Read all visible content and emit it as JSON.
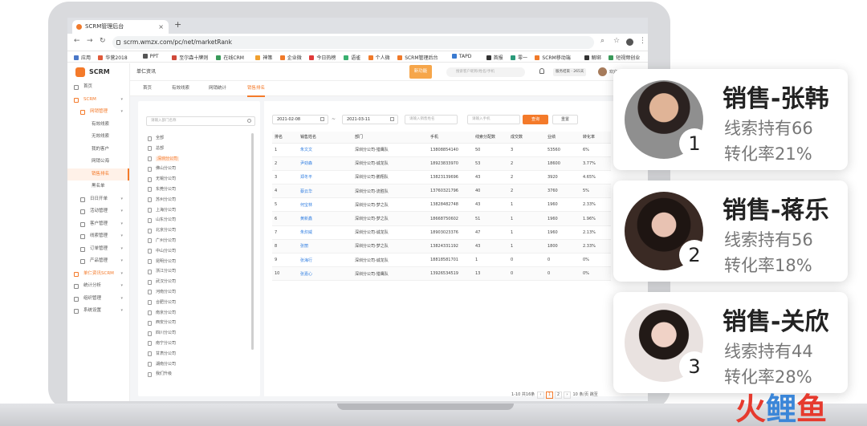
{
  "browser": {
    "tab_title": "SCRM管理后台",
    "url": "scrm.wmzx.com/pc/net/marketRank",
    "bookmarks": [
      "应用",
      "华营2018",
      "PPT",
      "至尔森十牌则",
      "在线CRM",
      "神策",
      "企业微",
      "今日热榜",
      "语雀",
      "个人微",
      "SCRM管理后台",
      "TAPD",
      "首报",
      "零一",
      "SCRM移动端",
      "解绑",
      "短视频创业"
    ]
  },
  "app": {
    "logo": "SCRM",
    "brand": "单仁资讯",
    "new_feature": "新功能",
    "search_placeholder": "搜索客户昵称/姓名/手机",
    "account": "服务结束 · 265天",
    "welcome": "欢迎!"
  },
  "sidebar": [
    {
      "label": "首页",
      "level": 0,
      "style": "normal"
    },
    {
      "label": "SCRM",
      "level": 0,
      "style": "orange",
      "chevron": true
    },
    {
      "label": "网销管理",
      "level": 1,
      "style": "orange",
      "chevron": true
    },
    {
      "label": "有效线索",
      "level": 2,
      "style": "normal"
    },
    {
      "label": "无效线索",
      "level": 2,
      "style": "normal"
    },
    {
      "label": "我的客户",
      "level": 2,
      "style": "normal"
    },
    {
      "label": "网销公海",
      "level": 2,
      "style": "normal"
    },
    {
      "label": "销售排名",
      "level": 2,
      "style": "active"
    },
    {
      "label": "黑名单",
      "level": 2,
      "style": "normal"
    },
    {
      "label": "日日开单",
      "level": 1,
      "style": "normal",
      "chevron": true
    },
    {
      "label": "活动管理",
      "level": 1,
      "style": "normal",
      "chevron": true
    },
    {
      "label": "客户管理",
      "level": 1,
      "style": "normal",
      "chevron": true
    },
    {
      "label": "线索管理",
      "level": 1,
      "style": "normal",
      "chevron": true
    },
    {
      "label": "订单管理",
      "level": 1,
      "style": "normal",
      "chevron": true
    },
    {
      "label": "产品管理",
      "level": 1,
      "style": "normal",
      "chevron": true
    },
    {
      "label": "单仁资讯SCRM",
      "level": 0,
      "style": "orange",
      "chevron": true
    },
    {
      "label": "统计分析",
      "level": 0,
      "style": "normal",
      "chevron": true
    },
    {
      "label": "组织管理",
      "level": 0,
      "style": "normal",
      "chevron": true
    },
    {
      "label": "系统设置",
      "level": 0,
      "style": "normal",
      "chevron": true
    }
  ],
  "subtabs": [
    "首页",
    "有效线索",
    "网销统计",
    "销售排名"
  ],
  "tree": {
    "placeholder": "请输入部门名称",
    "nodes": [
      "全部",
      "总部",
      "深圳分公司",
      "佛山分公司",
      "无锡分公司",
      "东莞分公司",
      "苏州分公司",
      "上海分公司",
      "山东分公司",
      "北京分公司",
      "广州分公司",
      "中山分公司",
      "昆明分公司",
      "浙江分公司",
      "武汉分公司",
      "河南分公司",
      "合肥分公司",
      "南京分公司",
      "西安分公司",
      "四川分公司",
      "南宁分公司",
      "甘肃分公司",
      "湖南分公司",
      "我们升级"
    ],
    "selected": 2
  },
  "filters": {
    "date_from": "2021-02-08",
    "date_to": "2021-03-11",
    "tilde": "~",
    "name_placeholder": "请输入销售姓名",
    "phone_placeholder": "请输入手机",
    "query": "查询",
    "reset": "重置"
  },
  "table": {
    "headers": [
      "排名",
      "销售姓名",
      "部门",
      "手机",
      "线索分配数",
      "成交数",
      "业绩",
      "转化率"
    ],
    "rows": [
      [
        "1",
        "朱文文",
        "深圳分公司-猎鹰队",
        "13808854140",
        "50",
        "3",
        "53560",
        "6%"
      ],
      [
        "2",
        "尹劲森",
        "深圳分公司-诚龙队",
        "18923833970",
        "53",
        "2",
        "18600",
        "3.77%"
      ],
      [
        "3",
        "郑冬平",
        "深圳分公司-鹏翔队",
        "13823139696",
        "43",
        "2",
        "3920",
        "4.65%"
      ],
      [
        "4",
        "蔡云华",
        "深圳分公司-流胜队",
        "13760321796",
        "40",
        "2",
        "3760",
        "5%"
      ],
      [
        "5",
        "何宝林",
        "深圳分公司-梦之队",
        "13828482748",
        "43",
        "1",
        "1960",
        "2.33%"
      ],
      [
        "6",
        "黄新鑫",
        "深圳分公司-梦之队",
        "18668750602",
        "51",
        "1",
        "1960",
        "1.96%"
      ],
      [
        "7",
        "朱炽威",
        "深圳分公司-诚龙队",
        "18903023376",
        "47",
        "1",
        "1960",
        "2.13%"
      ],
      [
        "8",
        "张丽",
        "深圳分公司-梦之队",
        "13824331192",
        "43",
        "1",
        "1800",
        "2.33%"
      ],
      [
        "9",
        "张海行",
        "深圳分公司-诚龙队",
        "18818581701",
        "1",
        "0",
        "0",
        "0%"
      ],
      [
        "10",
        "张嘉心",
        "深圳分公司-猎鹰队",
        "13926534519",
        "13",
        "0",
        "0",
        "0%"
      ]
    ]
  },
  "pager": {
    "summary": "1-10 共16条",
    "pages": [
      "1",
      "2"
    ],
    "per_page": "10 条/页",
    "jump": "跳至"
  },
  "cards": [
    {
      "rank": "1",
      "name": "销售-张韩",
      "leads": "线索持有66",
      "rate": "转化率21%"
    },
    {
      "rank": "2",
      "name": "销售-蒋乐",
      "leads": "线索持有56",
      "rate": "转化率18%"
    },
    {
      "rank": "3",
      "name": "销售-关欣",
      "leads": "线索持有44",
      "rate": "转化率28%"
    }
  ],
  "footer": {
    "text": "火鲤鱼",
    "colors": [
      "#e63a2e",
      "#3b86d8",
      "#e63a2e"
    ]
  },
  "colors": {
    "accent": "#f47a2a",
    "link": "#2f7de1"
  }
}
